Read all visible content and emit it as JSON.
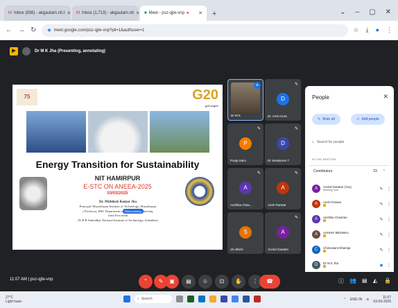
{
  "browser": {
    "tabs": [
      {
        "label": "Inbox (836) - akgautam.nit.t",
        "active": false
      },
      {
        "label": "Inbox (1,713) - akgautam.nit",
        "active": false
      },
      {
        "label": "Meet - psz-qjte-vnp",
        "active": true
      }
    ],
    "new_tab": "+",
    "window_controls": [
      "⌄",
      "–",
      "▢",
      "✕"
    ],
    "url": "meet.google.com/psz-qjte-vnp?pli=1&authuser=1"
  },
  "meet": {
    "presenter_bar": "Dr M K Jha (Presenting, annotating)",
    "slide": {
      "logo_left": "75",
      "g20": "G20",
      "g20_sub": "g20.org/in",
      "title": "Energy Transition for Sustainability",
      "institute": "NIT HAMIRPUR",
      "event": "E-STC ON ANEEA-2025",
      "date": "03/03/2025",
      "speaker_lines": [
        "Dr. Mithilesh Kumar Jha",
        "Principal, Muzaffarpur Institute of Technology, Muzaffarpur",
        "( Professor, IMG Department of Chemical Engineering",
        "Joint Fact          ment",
        "Dr B R Ambedkar National Institute of Technology, Jalandhar)"
      ],
      "badge": "Read pinning"
    },
    "tiles": [
      {
        "name": "Dr M K",
        "initial": "",
        "color": "",
        "video": true
      },
      {
        "name": "Dr. Amit Arora",
        "initial": "D",
        "color": "#1a73e8"
      },
      {
        "name": "Pooja Saini",
        "initial": "P",
        "color": "#f57c00"
      },
      {
        "name": "Dr Sivakumar T",
        "initial": "D",
        "color": "#3949ab"
      },
      {
        "name": "Anshika Chau...",
        "initial": "A",
        "color": "#5e35b1"
      },
      {
        "name": "Ansh Panwar",
        "initial": "A",
        "color": "#bf360c"
      },
      {
        "name": "16 others",
        "initial": "S",
        "color": "#e37400"
      },
      {
        "name": "Arvind Gautam",
        "initial": "A",
        "color": "#7b1fa2"
      }
    ],
    "people_panel": {
      "title": "People",
      "close": "✕",
      "mute_all": "Mute all",
      "add_people": "Add people",
      "search_placeholder": "Search for people",
      "section": "IN THE MEETING",
      "contributors_label": "Contributors",
      "contributors_count": "23",
      "people": [
        {
          "name": "Arvind Gautam (You)",
          "sub": "Meeting host",
          "initial": "A",
          "color": "#7b1fa2"
        },
        {
          "name": "Ansh Panwar",
          "sub": "",
          "initial": "A",
          "color": "#bf360c"
        },
        {
          "name": "Anshika Chauhan",
          "sub": "",
          "initial": "A",
          "color": "#5e35b1"
        },
        {
          "name": "ASHISH BENIWAL",
          "sub": "",
          "initial": "A",
          "color": "#6d4c41"
        },
        {
          "name": "Chinsukant Dhamija",
          "sub": "",
          "initial": "C",
          "color": "#1565c0"
        },
        {
          "name": "Dr M K Jha",
          "sub": "",
          "initial": "D",
          "color": "#455a64"
        }
      ]
    },
    "control_bar": {
      "time": "11:07 AM  |  psz-qjte-vnp"
    }
  },
  "taskbar": {
    "weather_temp": "27°C",
    "weather_text": "Light haze",
    "search": "Search",
    "time": "11:07",
    "date": "03-03-2025",
    "lang": "ENG IN"
  }
}
